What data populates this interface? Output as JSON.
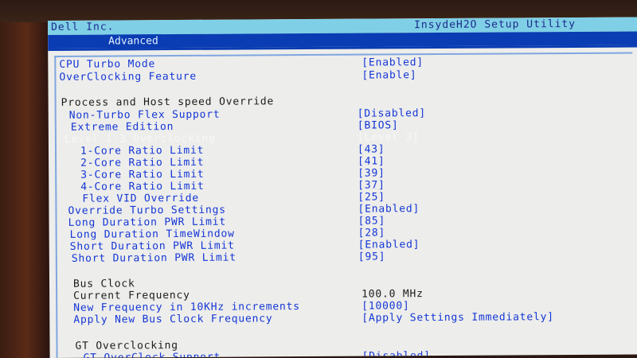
{
  "window": {
    "vendor": "Dell Inc.",
    "app_title": "InsydeH2O Setup Utility"
  },
  "tabs": [
    {
      "label": "Advanced",
      "active": true
    }
  ],
  "items": [
    {
      "label": "CPU Turbo Mode",
      "value": "[Enabled]"
    },
    {
      "label": "OverClocking Feature",
      "value": "[Enable]"
    },
    {
      "section": "Process and Host speed Override"
    },
    {
      "label": "Non-Turbo Flex Support",
      "value": "[Disabled]"
    },
    {
      "label": "Extreme Edition",
      "value": "[BIOS]"
    },
    {
      "label": "Level 1-3 Overclocking",
      "value": "[Level 3]",
      "selected": true
    },
    {
      "label": "1-Core Ratio Limit",
      "value": "[43]"
    },
    {
      "label": "2-Core Ratio Limit",
      "value": "[41]"
    },
    {
      "label": "3-Core Ratio Limit",
      "value": "[39]"
    },
    {
      "label": "4-Core Ratio Limit",
      "value": "[37]"
    },
    {
      "label": "Flex VID Override",
      "value": "[25]"
    },
    {
      "label": "Override Turbo Settings",
      "value": "[Enabled]"
    },
    {
      "label": "Long Duration PWR Limit",
      "value": "[85]"
    },
    {
      "label": "Long Duration TimeWindow",
      "value": "[28]"
    },
    {
      "label": "Short Duration PWR Limit",
      "value": "[Enabled]"
    },
    {
      "label": "Short Duration PWR Limit",
      "value": "[95]"
    },
    {
      "section": "Bus Clock"
    },
    {
      "label": "Current Frequency",
      "value": "100.0 MHz",
      "readonly": true
    },
    {
      "label": "New Frequency in 10KHz increments",
      "value": "[10000]"
    },
    {
      "label": "Apply New Bus Clock Frequency",
      "value": "[Apply Settings Immediately]"
    },
    {
      "section": "GT Overclocking"
    },
    {
      "label": "GT OverClock Support",
      "value": "[Disabled]"
    }
  ],
  "colors": {
    "screen_bg": "#ededeb",
    "title_bar": "#7fd0e6",
    "tab_bar": "#0a3cb3",
    "item_text": "#1336d6",
    "section_text": "#1c1c1c",
    "selected_text": "#f7f7f7"
  }
}
